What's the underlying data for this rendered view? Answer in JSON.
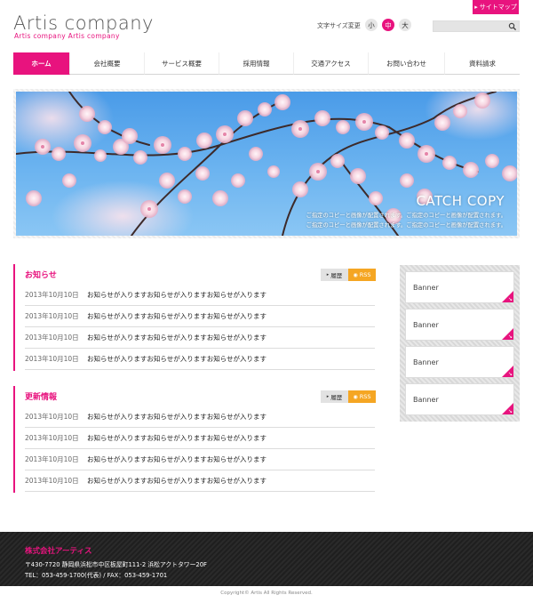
{
  "header": {
    "sitemap_label": "サイトマップ",
    "logo": "Artis company",
    "logo_sub": "Artis company Artis company",
    "fontsize_label": "文字サイズ変更",
    "fontsize_small": "小",
    "fontsize_medium": "中",
    "fontsize_large": "大",
    "search_placeholder": ""
  },
  "nav": {
    "items": [
      {
        "label": "ホーム"
      },
      {
        "label": "会社概要"
      },
      {
        "label": "サービス概要"
      },
      {
        "label": "採用情報"
      },
      {
        "label": "交通アクセス"
      },
      {
        "label": "お問い合わせ"
      },
      {
        "label": "資料請求"
      }
    ]
  },
  "hero": {
    "catch_copy": "CATCH COPY",
    "line1": "ご指定のコピーと画像が配置されます。ご指定のコピーと画像が配置されます。",
    "line2": "ご指定のコピーと画像が配置されます。ご指定のコピーと画像が配置されます。"
  },
  "news": {
    "title": "お知らせ",
    "history_label": "履歴",
    "rss_label": "RSS",
    "rows": [
      {
        "date": "2013年10月10日",
        "text": "お知らせが入りますお知らせが入りますお知らせが入ります"
      },
      {
        "date": "2013年10月10日",
        "text": "お知らせが入りますお知らせが入りますお知らせが入ります"
      },
      {
        "date": "2013年10月10日",
        "text": "お知らせが入りますお知らせが入りますお知らせが入ります"
      },
      {
        "date": "2013年10月10日",
        "text": "お知らせが入りますお知らせが入りますお知らせが入ります"
      }
    ]
  },
  "updates": {
    "title": "更新情報",
    "history_label": "履歴",
    "rss_label": "RSS",
    "rows": [
      {
        "date": "2013年10月10日",
        "text": "お知らせが入りますお知らせが入りますお知らせが入ります"
      },
      {
        "date": "2013年10月10日",
        "text": "お知らせが入りますお知らせが入りますお知らせが入ります"
      },
      {
        "date": "2013年10月10日",
        "text": "お知らせが入りますお知らせが入りますお知らせが入ります"
      },
      {
        "date": "2013年10月10日",
        "text": "お知らせが入りますお知らせが入りますお知らせが入ります"
      }
    ]
  },
  "banners": [
    {
      "label": "Banner"
    },
    {
      "label": "Banner"
    },
    {
      "label": "Banner"
    },
    {
      "label": "Banner"
    }
  ],
  "footer": {
    "company": "株式会社アーティス",
    "address": "〒430-7720 静岡県浜松市中区板屋町111-2 浜松アクトタワー20F",
    "tel": "TEL：053-459-1700(代表) / FAX：053-459-1701",
    "copyright": "Copyright© Artis All Rights Reserved."
  },
  "colors": {
    "accent": "#e8137e",
    "rss": "#f5a623"
  }
}
